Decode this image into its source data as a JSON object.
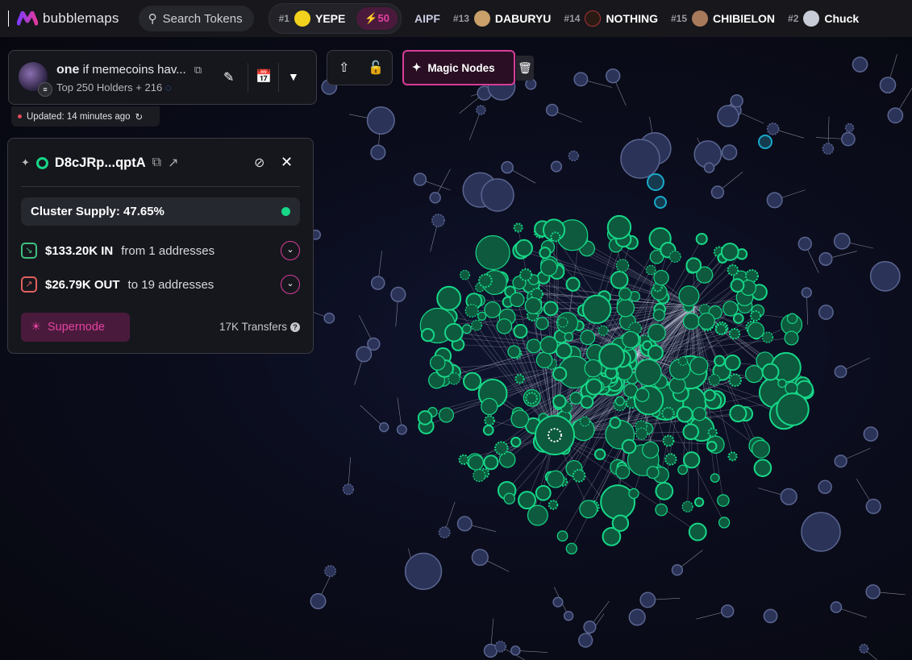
{
  "app": {
    "name": "bubblemaps"
  },
  "search": {
    "placeholder": "Search Tokens"
  },
  "trending": [
    {
      "rank": "#1",
      "name": "YEPE",
      "boost": "50",
      "avatar_color": "#f2d21c"
    },
    {
      "rank": "",
      "name": "AIPF",
      "avatar_color": ""
    },
    {
      "rank": "#13",
      "name": "DABURYU",
      "avatar_color": "#c9a06a"
    },
    {
      "rank": "#14",
      "name": "NOTHING",
      "avatar_color": "#2a1a14"
    },
    {
      "rank": "#15",
      "name": "CHIBIELON",
      "avatar_color": "#a87a5c"
    },
    {
      "rank": "#2",
      "name": "Chuck",
      "avatar_color": "#c8ccd6"
    }
  ],
  "token": {
    "symbol": "one",
    "name": "if memecoins hav...",
    "subtitle": "Top 250 Holders + 216",
    "updated": "Updated: 14 minutes ago"
  },
  "toolbar": {
    "magic_nodes": "Magic Nodes"
  },
  "cluster": {
    "address": "D8cJRp...qptA",
    "supply": "Cluster Supply: 47.65%",
    "in_amount": "$133.20K IN",
    "in_desc": "from 1 addresses",
    "out_amount": "$26.79K OUT",
    "out_desc": "to 19 addresses",
    "supernode": "Supernode",
    "transfers": "17K Transfers"
  },
  "colors": {
    "accent": "#d63d9a",
    "cluster": "#17d788",
    "node": "#2b3358",
    "node_border": "#5a6590",
    "highlight": "#19a9c9"
  }
}
